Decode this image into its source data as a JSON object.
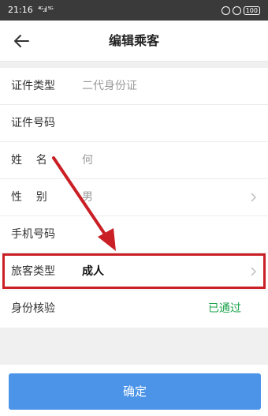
{
  "status_bar": {
    "time": "21:16",
    "signal": "⁴ᴳ.ıl ⁵ᴳ",
    "battery": "100"
  },
  "header": {
    "title": "编辑乘客"
  },
  "form": {
    "rows": [
      {
        "label": "证件类型",
        "value": "二代身份证"
      },
      {
        "label": "证件号码",
        "value": ""
      },
      {
        "label": "姓    名",
        "value": "何"
      },
      {
        "label": "性    别",
        "value": "男"
      },
      {
        "label": "手机号码",
        "value": ""
      },
      {
        "label": "旅客类型",
        "value": "成人"
      },
      {
        "label": "身份核验",
        "status": "已通过"
      }
    ]
  },
  "footer": {
    "confirm_label": "确定"
  },
  "colors": {
    "accent": "#4b94e8",
    "verified": "#1aa34a",
    "highlight": "#c91f25"
  }
}
